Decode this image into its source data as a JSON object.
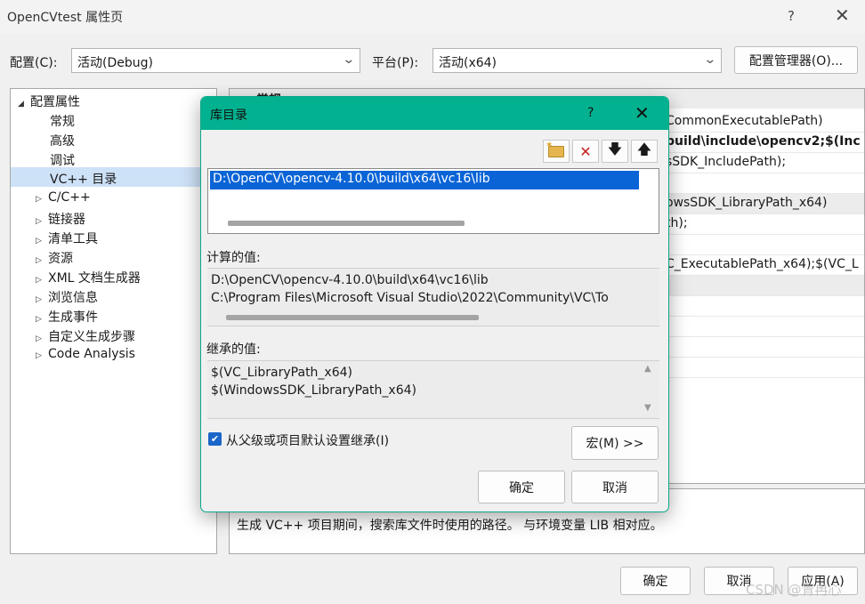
{
  "window": {
    "title": "OpenCVtest 属性页",
    "help_glyph": "?",
    "close_glyph": "✕"
  },
  "config_bar": {
    "config_label": "配置(C):",
    "config_value": "活动(Debug)",
    "platform_label": "平台(P):",
    "platform_value": "活动(x64)",
    "manager_button": "配置管理器(O)..."
  },
  "tree": {
    "root": "配置属性",
    "items": [
      {
        "label": "常规",
        "expandable": false
      },
      {
        "label": "高级",
        "expandable": false
      },
      {
        "label": "调试",
        "expandable": false
      },
      {
        "label": "VC++ 目录",
        "expandable": false,
        "selected": true
      },
      {
        "label": "C/C++",
        "expandable": true
      },
      {
        "label": "链接器",
        "expandable": true
      },
      {
        "label": "清单工具",
        "expandable": true
      },
      {
        "label": "资源",
        "expandable": true
      },
      {
        "label": "XML 文档生成器",
        "expandable": true
      },
      {
        "label": "浏览信息",
        "expandable": true
      },
      {
        "label": "生成事件",
        "expandable": true
      },
      {
        "label": "自定义生成步骤",
        "expandable": true
      },
      {
        "label": "Code Analysis",
        "expandable": true
      }
    ]
  },
  "grid": {
    "header_fragment": "常规",
    "values": [
      "CommonExecutablePath)",
      "build\\include\\opencv2;$(Inc",
      "sSDK_IncludePath);",
      "",
      "owsSDK_LibraryPath_x64)",
      "th);",
      "",
      "C_ExecutablePath_x64);$(VC_L"
    ]
  },
  "description": "生成 VC++ 项目期间，搜索库文件时使用的路径。 与环境变量 LIB 相对应。",
  "bottom_buttons": {
    "ok": "确定",
    "cancel": "取消",
    "apply": "应用(A)"
  },
  "watermark": "CSDN @青冉心",
  "dialog": {
    "title": "库目录",
    "help_glyph": "?",
    "close_glyph": "✕",
    "toolbar_icons": [
      "new-folder-icon",
      "delete-icon",
      "move-down-icon",
      "move-up-icon"
    ],
    "entries": [
      "D:\\OpenCV\\opencv-4.10.0\\build\\x64\\vc16\\lib"
    ],
    "evaluated_label": "计算的值:",
    "evaluated_values": [
      "D:\\OpenCV\\opencv-4.10.0\\build\\x64\\vc16\\lib",
      "C:\\Program Files\\Microsoft Visual Studio\\2022\\Community\\VC\\To"
    ],
    "inherited_label": "继承的值:",
    "inherited_values": [
      "$(VC_LibraryPath_x64)",
      "$(WindowsSDK_LibraryPath_x64)"
    ],
    "inherit_checkbox_label": "从父级或项目默认设置继承(I)",
    "inherit_checked": true,
    "macros_button": "宏(M) >>",
    "ok": "确定",
    "cancel": "取消"
  }
}
